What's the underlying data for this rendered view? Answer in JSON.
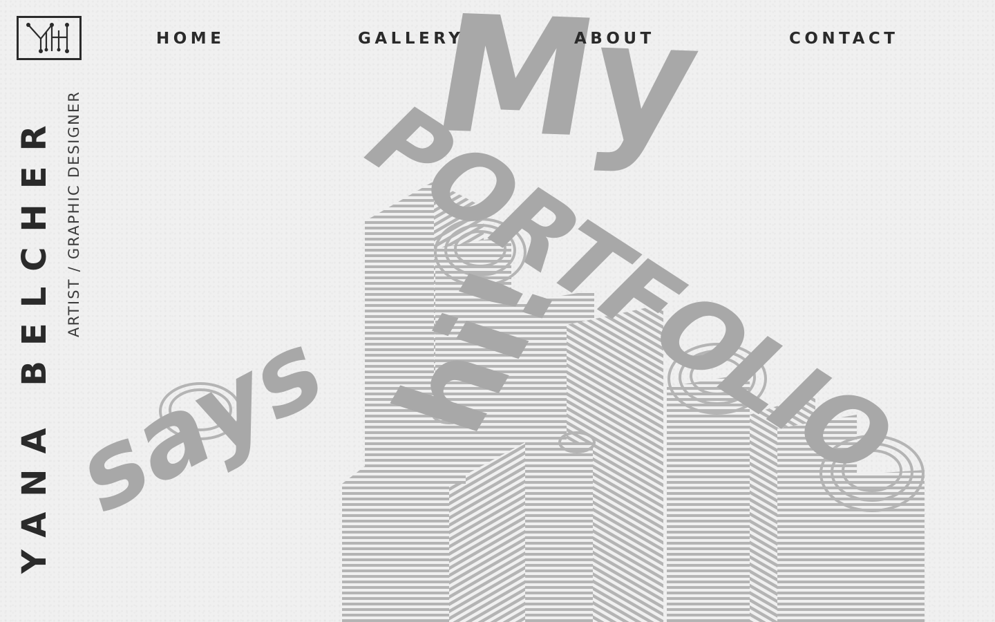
{
  "brand": {
    "name": "YANA BELCHER",
    "subtitle": "ARTIST / GRAPHIC DESIGNER",
    "logo_icon": "yh-monogram-icon"
  },
  "nav": {
    "items": [
      {
        "label": "HOME"
      },
      {
        "label": "GALLERY"
      },
      {
        "label": "ABOUT"
      },
      {
        "label": "CONTACT"
      }
    ]
  },
  "hero": {
    "word_my": "My",
    "word_portfolio": "PORTFOLIO",
    "word_says": "says",
    "word_hi": "hi!"
  },
  "colors": {
    "text": "#2a2a2a",
    "background": "#f0f0f0",
    "artwork": "#b3b3b3"
  }
}
